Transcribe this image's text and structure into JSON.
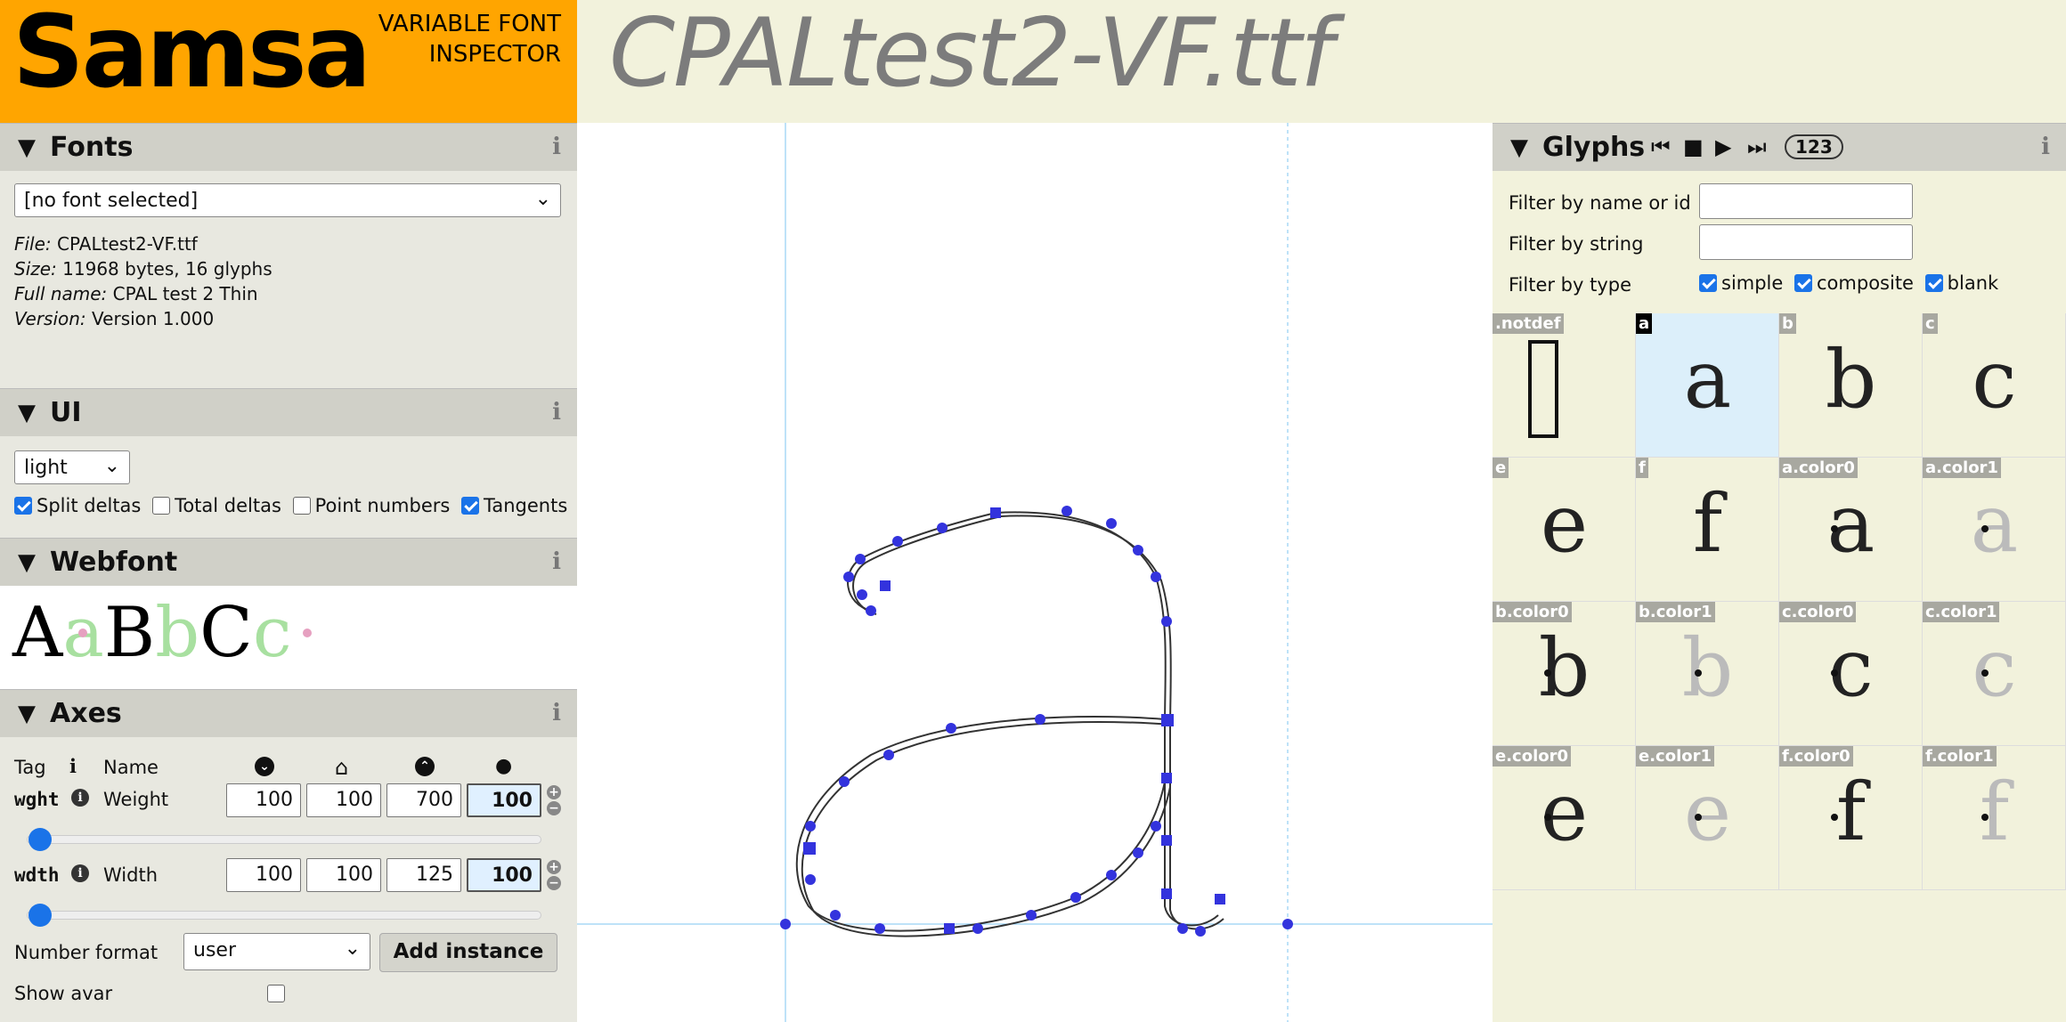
{
  "app": {
    "name": "Samsa",
    "tagline_line1": "VARIABLE FONT",
    "tagline_line2": "INSPECTOR"
  },
  "document_title": "CPALtest2-VF.ttf",
  "fonts_panel": {
    "title": "Fonts",
    "select_value": "[no font selected]",
    "file_label": "File:",
    "file_value": "CPALtest2-VF.ttf",
    "size_label": "Size:",
    "size_value": "11968 bytes, 16 glyphs",
    "fullname_label": "Full name:",
    "fullname_value": "CPAL test 2 Thin",
    "version_label": "Version:",
    "version_value": "Version 1.000"
  },
  "ui_panel": {
    "title": "UI",
    "theme": "light",
    "checkboxes": [
      {
        "label": "Split deltas",
        "checked": true
      },
      {
        "label": "Total deltas",
        "checked": false
      },
      {
        "label": "Point numbers",
        "checked": false
      },
      {
        "label": "Tangents",
        "checked": true
      }
    ]
  },
  "webfont_panel": {
    "title": "Webfont",
    "sample_letters": [
      "A",
      "a",
      "B",
      "b",
      "C",
      "c"
    ]
  },
  "axes_panel": {
    "title": "Axes",
    "col_tag": "Tag",
    "col_name": "Name",
    "axes": [
      {
        "tag": "wght",
        "name": "Weight",
        "min": "100",
        "default": "100",
        "max": "700",
        "current": "100",
        "position_fraction": 0
      },
      {
        "tag": "wdth",
        "name": "Width",
        "min": "100",
        "default": "100",
        "max": "125",
        "current": "100",
        "position_fraction": 0
      }
    ],
    "number_format_label": "Number format",
    "number_format_value": "user",
    "add_instance_label": "Add instance",
    "show_avar_label": "Show avar",
    "show_avar_checked": false
  },
  "glyphs_panel": {
    "title": "Glyphs",
    "count_badge": "123",
    "filter_name_label": "Filter by name or id",
    "filter_string_label": "Filter by string",
    "filter_type_label": "Filter by type",
    "type_filters": [
      {
        "label": "simple",
        "checked": true
      },
      {
        "label": "composite",
        "checked": true
      },
      {
        "label": "blank",
        "checked": true
      }
    ],
    "glyphs": [
      {
        "name": ".notdef",
        "char": "",
        "selected": false,
        "style": "notdef"
      },
      {
        "name": "a",
        "char": "a",
        "selected": true,
        "style": "thin"
      },
      {
        "name": "b",
        "char": "b",
        "selected": false,
        "style": "thin"
      },
      {
        "name": "c",
        "char": "c",
        "selected": false,
        "style": "thin"
      },
      {
        "name": "e",
        "char": "e",
        "selected": false,
        "style": "thin"
      },
      {
        "name": "f",
        "char": "f",
        "selected": false,
        "style": "thin"
      },
      {
        "name": "a.color0",
        "char": "a",
        "selected": false,
        "style": "color0"
      },
      {
        "name": "a.color1",
        "char": "a",
        "selected": false,
        "style": "color1"
      },
      {
        "name": "b.color0",
        "char": "b",
        "selected": false,
        "style": "color0"
      },
      {
        "name": "b.color1",
        "char": "b",
        "selected": false,
        "style": "color1"
      },
      {
        "name": "c.color0",
        "char": "c",
        "selected": false,
        "style": "color0"
      },
      {
        "name": "c.color1",
        "char": "c",
        "selected": false,
        "style": "color1"
      },
      {
        "name": "e.color0",
        "char": "e",
        "selected": false,
        "style": "color0"
      },
      {
        "name": "e.color1",
        "char": "e",
        "selected": false,
        "style": "color1"
      },
      {
        "name": "f.color0",
        "char": "f",
        "selected": false,
        "style": "color0"
      },
      {
        "name": "f.color1",
        "char": "f",
        "selected": false,
        "style": "color1"
      }
    ]
  },
  "colors": {
    "accent": "#ffa500",
    "point": "#3333dd",
    "guide": "#66bbff"
  }
}
